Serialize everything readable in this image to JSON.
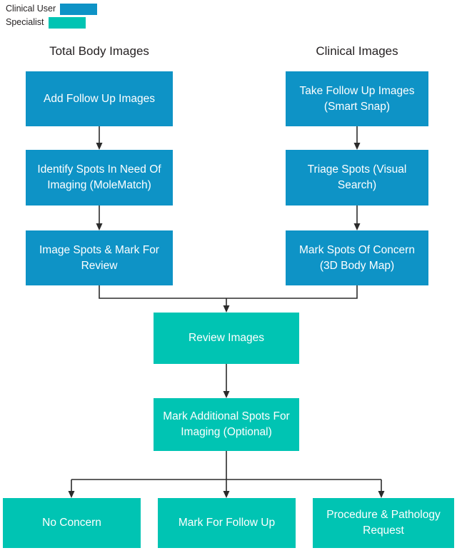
{
  "legend": {
    "items": [
      {
        "label": "Clinical User",
        "color": "#0e93c6",
        "swatch_name": "legend-swatch-clinical-user"
      },
      {
        "label": "Specialist",
        "color": "#00c4b3",
        "swatch_name": "legend-swatch-specialist"
      }
    ]
  },
  "colors": {
    "clinical_user": "#0e93c6",
    "specialist": "#00c4b3",
    "connector": "#2b2b2b",
    "text_dark": "#231f20",
    "node_text": "#ffffff",
    "background": "#ffffff"
  },
  "columns": {
    "left_heading": "Total Body Images",
    "right_heading": "Clinical Images"
  },
  "nodes": {
    "left": [
      {
        "id": "add-follow-up-images",
        "text": "Add Follow Up Images",
        "role": "Clinical User"
      },
      {
        "id": "identify-spots",
        "text": "Identify Spots In Need Of Imaging (MoleMatch)",
        "role": "Clinical User"
      },
      {
        "id": "image-spots-mark-review",
        "text": "Image Spots & Mark For Review",
        "role": "Clinical User"
      }
    ],
    "right": [
      {
        "id": "take-follow-up-images",
        "text": "Take Follow Up Images (Smart Snap)",
        "role": "Clinical User"
      },
      {
        "id": "triage-spots",
        "text": "Triage Spots (Visual Search)",
        "role": "Clinical User"
      },
      {
        "id": "mark-spots-of-concern",
        "text": "Mark Spots Of Concern (3D Body Map)",
        "role": "Clinical User"
      }
    ],
    "center": [
      {
        "id": "review-images",
        "text": "Review Images",
        "role": "Specialist"
      },
      {
        "id": "mark-additional-spots",
        "text": "Mark Additional Spots For Imaging (Optional)",
        "role": "Specialist"
      }
    ],
    "outcomes": [
      {
        "id": "no-concern",
        "text": "No Concern",
        "role": "Specialist"
      },
      {
        "id": "mark-for-follow-up",
        "text": "Mark For Follow Up",
        "role": "Specialist"
      },
      {
        "id": "procedure-pathology-request",
        "text": "Procedure & Pathology Request",
        "role": "Specialist"
      }
    ]
  }
}
